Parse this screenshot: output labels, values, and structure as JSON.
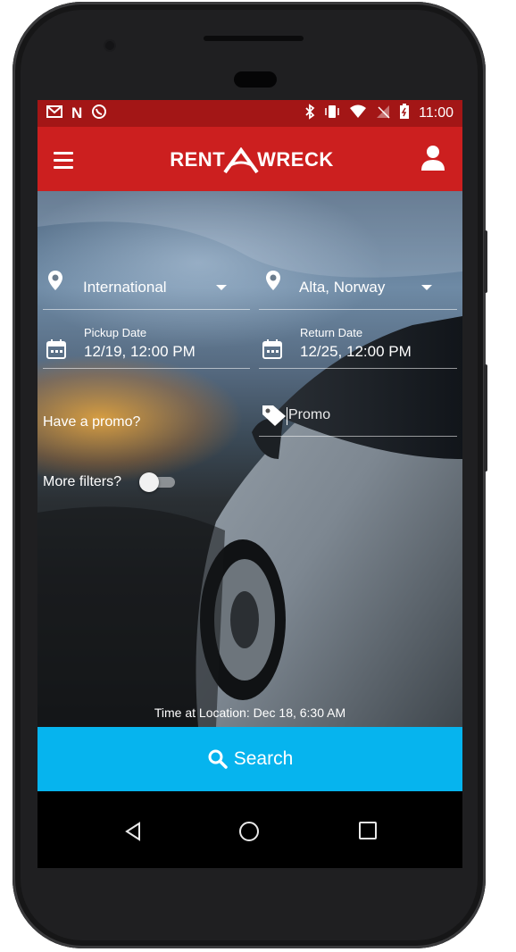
{
  "status_bar": {
    "time": "11:00",
    "left_icons": [
      "gmail-icon",
      "n-icon",
      "whatsapp-icon"
    ],
    "right_icons": [
      "bluetooth-icon",
      "vibrate-icon",
      "wifi-icon",
      "signal-icon",
      "battery-icon"
    ]
  },
  "header": {
    "logo_text_left": "RENT",
    "logo_text_right": "WRECK",
    "brand_color": "#cc1f1f",
    "status_color": "#a31616"
  },
  "search_form": {
    "country": {
      "value": "International"
    },
    "location": {
      "value": "Alta, Norway"
    },
    "pickup": {
      "label": "Pickup Date",
      "value": "12/19, 12:00 PM"
    },
    "return": {
      "label": "Return Date",
      "value": "12/25, 12:00 PM"
    },
    "promo": {
      "prompt": "Have a promo?",
      "placeholder": "Promo"
    },
    "filters": {
      "label": "More filters?",
      "enabled": false
    }
  },
  "time_at_location": "Time at Location: Dec 18, 6:30 AM",
  "search_button": {
    "label": "Search",
    "color": "#06b4ee"
  }
}
